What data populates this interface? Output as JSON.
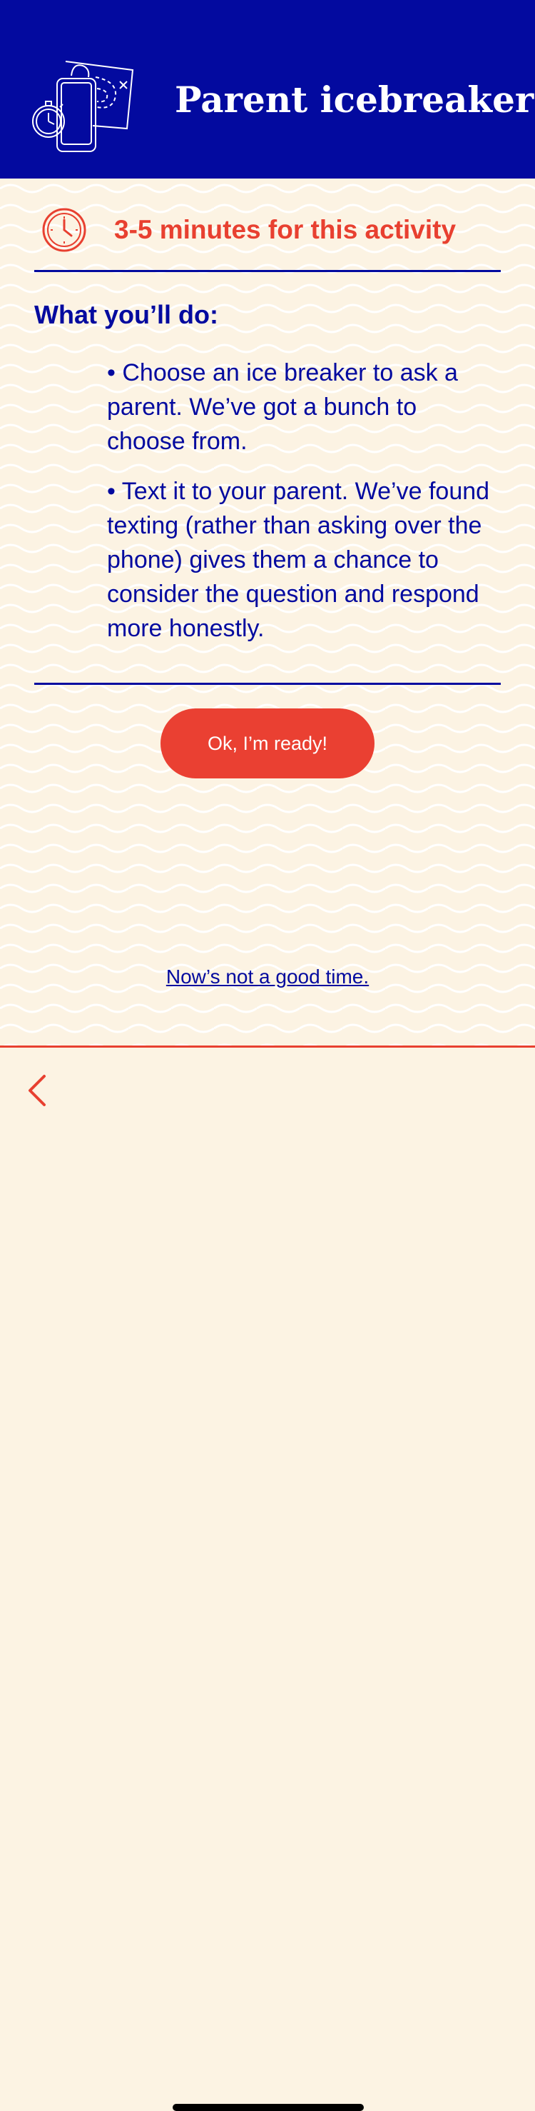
{
  "header": {
    "title": "Parent icebreaker",
    "icon": "phone-map-stopwatch-icon"
  },
  "activity": {
    "duration_text": "3-5 minutes for this activity",
    "clock_icon": "clock-icon"
  },
  "section": {
    "title": "What you’ll do:",
    "bullets": [
      "• Choose an ice breaker to ask a parent. We’ve got a bunch to choose from.",
      "• Text it to your parent. We’ve found texting (rather than asking over the phone) gives them a chance to consider the question and respond more honestly."
    ]
  },
  "actions": {
    "ready_label": "Ok, I’m ready!",
    "not_now_label": "Now’s not a good time."
  },
  "nav": {
    "back_icon": "chevron-left-icon"
  },
  "colors": {
    "primary_blue": "#030a9f",
    "accent_red": "#ea4032",
    "background": "#fcf3e3"
  }
}
